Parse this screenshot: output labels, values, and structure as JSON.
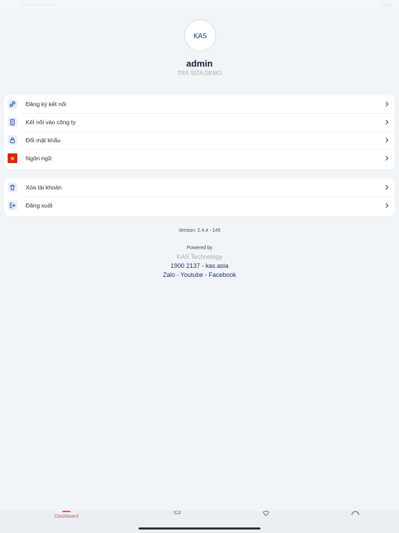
{
  "profile": {
    "logo_text": "KAS",
    "username": "admin",
    "company": "TRÀ SỮA DEMO"
  },
  "menu_group_1": [
    {
      "label": "Đăng ký kết nối",
      "icon": "link-icon"
    },
    {
      "label": "Kết nối vào công ty",
      "icon": "building-icon"
    },
    {
      "label": "Đổi mật khẩu",
      "icon": "lock-icon"
    },
    {
      "label": "Ngôn ngữ",
      "icon": "vietnam-flag-icon"
    }
  ],
  "menu_group_2": [
    {
      "label": "Xóa tài khoản",
      "icon": "trash-icon"
    },
    {
      "label": "Đăng xuất",
      "icon": "logout-icon"
    }
  ],
  "footer": {
    "version": "Version: 2.4.4 - 145",
    "powered_by": "Powered by",
    "company_name": "KAS Technology",
    "hotline": "1900 2137 - kas.asia",
    "zalo": "Zalo",
    "youtube": "Youtube",
    "facebook": "Facebook",
    "separator": " - "
  },
  "tabbar": {
    "dashboard_label": "Dashboard"
  },
  "colors": {
    "accent": "#e0505a",
    "link": "#1d3270",
    "icon_blue": "#2a4ea8",
    "flag_red": "#da251d",
    "flag_star": "#ffde00"
  }
}
